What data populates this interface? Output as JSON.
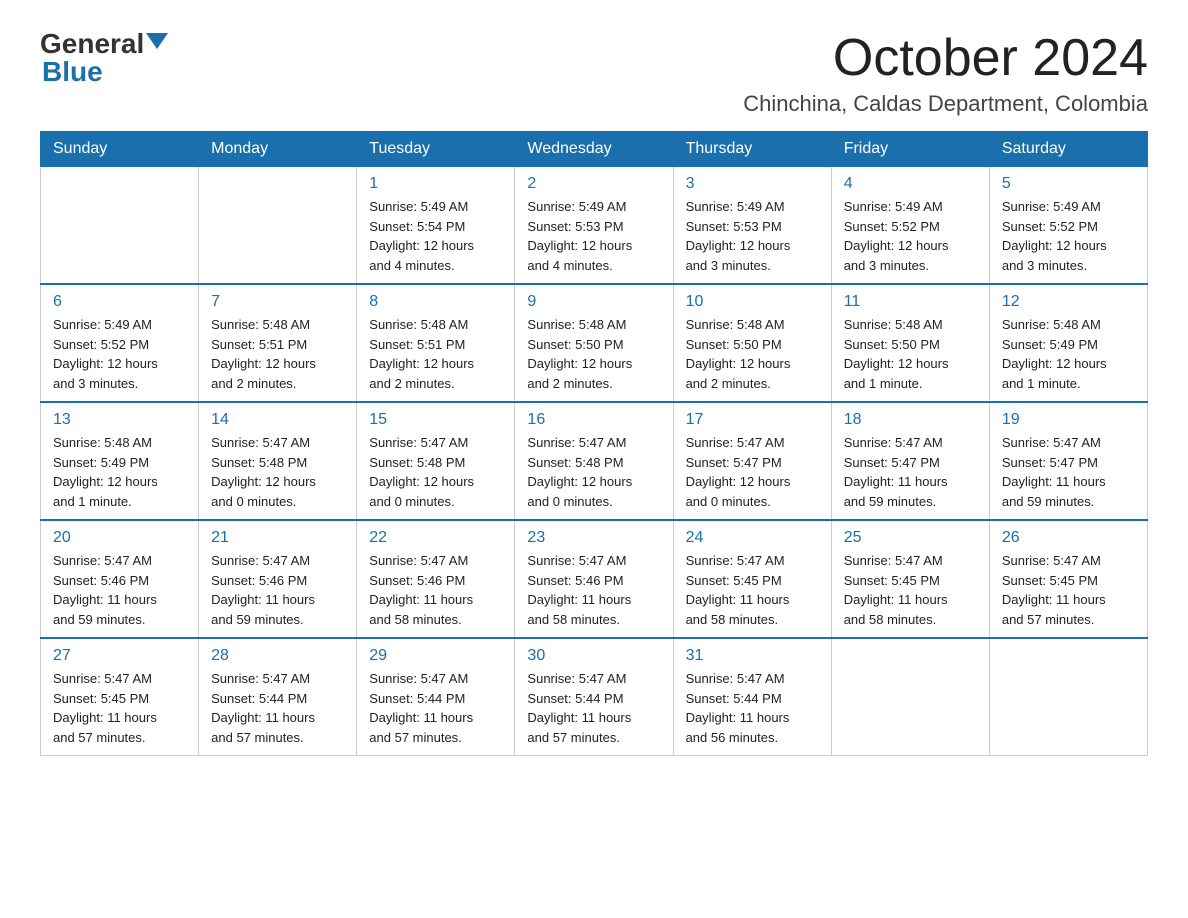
{
  "header": {
    "logo_general": "General",
    "logo_blue": "Blue",
    "month_title": "October 2024",
    "location": "Chinchina, Caldas Department, Colombia"
  },
  "days_of_week": [
    "Sunday",
    "Monday",
    "Tuesday",
    "Wednesday",
    "Thursday",
    "Friday",
    "Saturday"
  ],
  "weeks": [
    [
      {
        "day": "",
        "info": ""
      },
      {
        "day": "",
        "info": ""
      },
      {
        "day": "1",
        "info": "Sunrise: 5:49 AM\nSunset: 5:54 PM\nDaylight: 12 hours\nand 4 minutes."
      },
      {
        "day": "2",
        "info": "Sunrise: 5:49 AM\nSunset: 5:53 PM\nDaylight: 12 hours\nand 4 minutes."
      },
      {
        "day": "3",
        "info": "Sunrise: 5:49 AM\nSunset: 5:53 PM\nDaylight: 12 hours\nand 3 minutes."
      },
      {
        "day": "4",
        "info": "Sunrise: 5:49 AM\nSunset: 5:52 PM\nDaylight: 12 hours\nand 3 minutes."
      },
      {
        "day": "5",
        "info": "Sunrise: 5:49 AM\nSunset: 5:52 PM\nDaylight: 12 hours\nand 3 minutes."
      }
    ],
    [
      {
        "day": "6",
        "info": "Sunrise: 5:49 AM\nSunset: 5:52 PM\nDaylight: 12 hours\nand 3 minutes."
      },
      {
        "day": "7",
        "info": "Sunrise: 5:48 AM\nSunset: 5:51 PM\nDaylight: 12 hours\nand 2 minutes."
      },
      {
        "day": "8",
        "info": "Sunrise: 5:48 AM\nSunset: 5:51 PM\nDaylight: 12 hours\nand 2 minutes."
      },
      {
        "day": "9",
        "info": "Sunrise: 5:48 AM\nSunset: 5:50 PM\nDaylight: 12 hours\nand 2 minutes."
      },
      {
        "day": "10",
        "info": "Sunrise: 5:48 AM\nSunset: 5:50 PM\nDaylight: 12 hours\nand 2 minutes."
      },
      {
        "day": "11",
        "info": "Sunrise: 5:48 AM\nSunset: 5:50 PM\nDaylight: 12 hours\nand 1 minute."
      },
      {
        "day": "12",
        "info": "Sunrise: 5:48 AM\nSunset: 5:49 PM\nDaylight: 12 hours\nand 1 minute."
      }
    ],
    [
      {
        "day": "13",
        "info": "Sunrise: 5:48 AM\nSunset: 5:49 PM\nDaylight: 12 hours\nand 1 minute."
      },
      {
        "day": "14",
        "info": "Sunrise: 5:47 AM\nSunset: 5:48 PM\nDaylight: 12 hours\nand 0 minutes."
      },
      {
        "day": "15",
        "info": "Sunrise: 5:47 AM\nSunset: 5:48 PM\nDaylight: 12 hours\nand 0 minutes."
      },
      {
        "day": "16",
        "info": "Sunrise: 5:47 AM\nSunset: 5:48 PM\nDaylight: 12 hours\nand 0 minutes."
      },
      {
        "day": "17",
        "info": "Sunrise: 5:47 AM\nSunset: 5:47 PM\nDaylight: 12 hours\nand 0 minutes."
      },
      {
        "day": "18",
        "info": "Sunrise: 5:47 AM\nSunset: 5:47 PM\nDaylight: 11 hours\nand 59 minutes."
      },
      {
        "day": "19",
        "info": "Sunrise: 5:47 AM\nSunset: 5:47 PM\nDaylight: 11 hours\nand 59 minutes."
      }
    ],
    [
      {
        "day": "20",
        "info": "Sunrise: 5:47 AM\nSunset: 5:46 PM\nDaylight: 11 hours\nand 59 minutes."
      },
      {
        "day": "21",
        "info": "Sunrise: 5:47 AM\nSunset: 5:46 PM\nDaylight: 11 hours\nand 59 minutes."
      },
      {
        "day": "22",
        "info": "Sunrise: 5:47 AM\nSunset: 5:46 PM\nDaylight: 11 hours\nand 58 minutes."
      },
      {
        "day": "23",
        "info": "Sunrise: 5:47 AM\nSunset: 5:46 PM\nDaylight: 11 hours\nand 58 minutes."
      },
      {
        "day": "24",
        "info": "Sunrise: 5:47 AM\nSunset: 5:45 PM\nDaylight: 11 hours\nand 58 minutes."
      },
      {
        "day": "25",
        "info": "Sunrise: 5:47 AM\nSunset: 5:45 PM\nDaylight: 11 hours\nand 58 minutes."
      },
      {
        "day": "26",
        "info": "Sunrise: 5:47 AM\nSunset: 5:45 PM\nDaylight: 11 hours\nand 57 minutes."
      }
    ],
    [
      {
        "day": "27",
        "info": "Sunrise: 5:47 AM\nSunset: 5:45 PM\nDaylight: 11 hours\nand 57 minutes."
      },
      {
        "day": "28",
        "info": "Sunrise: 5:47 AM\nSunset: 5:44 PM\nDaylight: 11 hours\nand 57 minutes."
      },
      {
        "day": "29",
        "info": "Sunrise: 5:47 AM\nSunset: 5:44 PM\nDaylight: 11 hours\nand 57 minutes."
      },
      {
        "day": "30",
        "info": "Sunrise: 5:47 AM\nSunset: 5:44 PM\nDaylight: 11 hours\nand 57 minutes."
      },
      {
        "day": "31",
        "info": "Sunrise: 5:47 AM\nSunset: 5:44 PM\nDaylight: 11 hours\nand 56 minutes."
      },
      {
        "day": "",
        "info": ""
      },
      {
        "day": "",
        "info": ""
      }
    ]
  ]
}
